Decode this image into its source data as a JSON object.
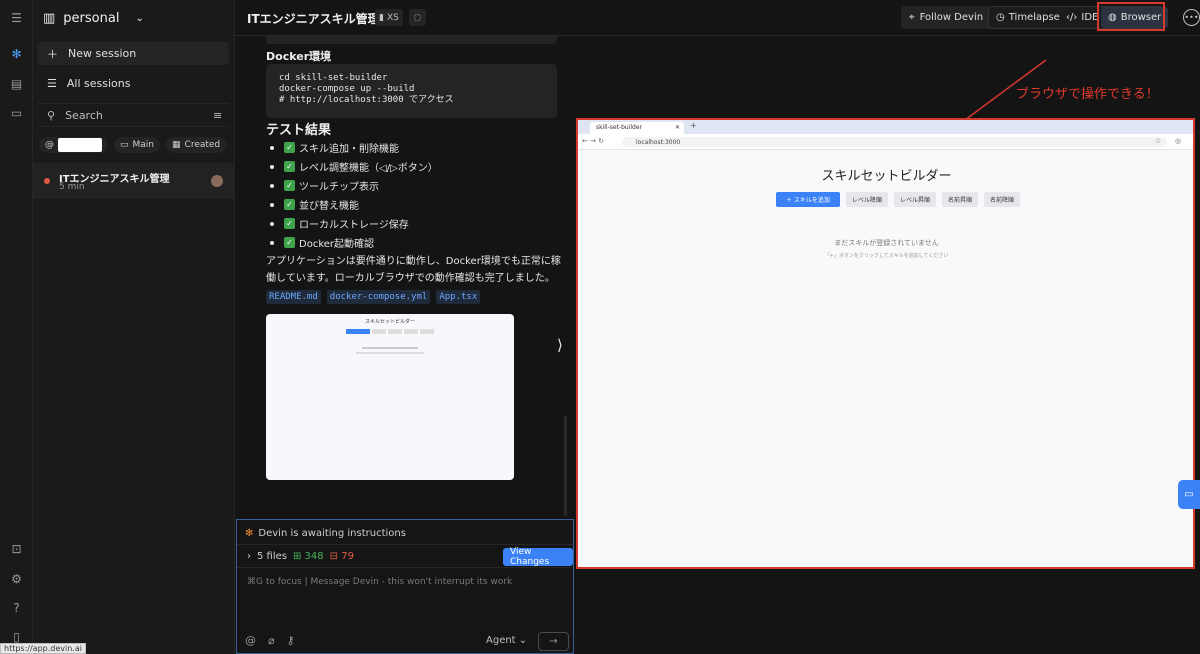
{
  "sidebar": {
    "workspace": "personal",
    "new_session": "New session",
    "all_sessions": "All sessions",
    "search_placeholder": "Search",
    "chips": {
      "branch": "Main",
      "sort": "Created"
    },
    "session": {
      "title": "ITエンジニアスキル管理",
      "time": "5 min",
      "status_color": "#e25b45"
    }
  },
  "topbar": {
    "title": "ITエンジニアスキル管理",
    "size_badge": "XS",
    "follow": "Follow Devin",
    "timelapse": "Timelapse",
    "ide": "IDE",
    "browser": "Browser"
  },
  "chat": {
    "docker_heading": "Docker環境",
    "code_lines": [
      "cd skill-set-builder",
      "docker-compose up --build",
      "# http://localhost:3000 でアクセス"
    ],
    "test_heading": "テスト結果",
    "checks": [
      "スキル追加・削除機能",
      "レベル調整機能（◁/▷ボタン）",
      "ツールチップ表示",
      "並び替え機能",
      "ローカルストレージ保存",
      "Docker起動確認"
    ],
    "summary": "アプリケーションは要件通りに動作し、Docker環境でも正常に稼働しています。ローカルブラウザでの動作確認も完了しました。",
    "files": [
      "README.md",
      "docker-compose.yml",
      "App.tsx"
    ]
  },
  "composer": {
    "status": "Devin is awaiting instructions",
    "files_count": "5 files",
    "additions": "348",
    "deletions": "79",
    "view_changes": "View Changes",
    "placeholder": "⌘G to focus | Message Devin - this won't interrupt its work",
    "mode": "Agent"
  },
  "browser": {
    "annotation": "ブラウザで操作できる！",
    "tab_title": "skill-set-builder",
    "url": "localhost:3000",
    "page_title": "スキルセットビルダー",
    "add_button": "＋ スキルを追加",
    "sort_buttons": [
      "レベル降順",
      "レベル昇順",
      "名前昇順",
      "名前降順"
    ],
    "empty_text": "まだスキルが登録されていません",
    "hint_text": "「+」ボタンをクリックしてスキルを追加してください"
  },
  "status_url": "https://app.devin.ai",
  "colors": {
    "accent": "#3b82f6",
    "annotation": "#d63a2e",
    "success": "#3ea34a"
  }
}
